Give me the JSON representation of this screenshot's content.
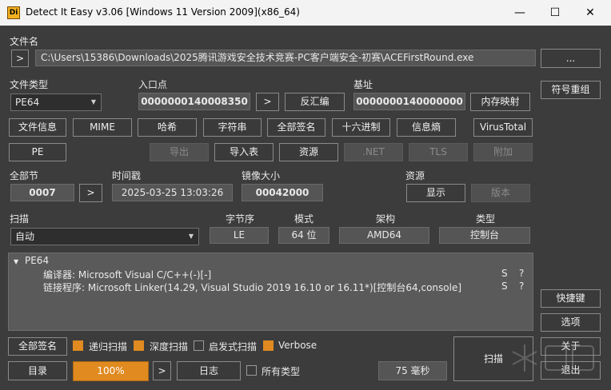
{
  "window": {
    "title": "Detect It Easy v3.06 [Windows 11 Version 2009](x86_64)",
    "icon_text": "Di",
    "minimize": "—",
    "maximize": "☐",
    "close": "✕"
  },
  "file": {
    "label": "文件名",
    "prev_btn": ">",
    "path": "C:\\Users\\15386\\Downloads\\2025腾讯游戏安全技术竞赛-PC客户端安全-初赛\\ACEFirstRound.exe",
    "browse": "..."
  },
  "filetype": {
    "label": "文件类型",
    "value": "PE64"
  },
  "entry": {
    "label": "入口点",
    "value": "0000000140008350",
    "go": ">",
    "disasm": "反汇编"
  },
  "base": {
    "label": "基址",
    "value": "0000000140000000",
    "memmap": "内存映射"
  },
  "right": {
    "sym": "符号重组",
    "shortcut": "快捷键",
    "options": "选项",
    "about": "关于",
    "exit": "退出"
  },
  "toolbar1": [
    "文件信息",
    "MIME",
    "哈希",
    "字符串",
    "全部签名",
    "十六进制",
    "信息熵",
    "VirusTotal"
  ],
  "toolbar2": {
    "pe": "PE",
    "export": "导出",
    "import": "导入表",
    "resource": "资源",
    "net": ".NET",
    "tls": "TLS",
    "overlay": "附加"
  },
  "sections": {
    "label": "全部节",
    "value": "0007",
    "go": ">"
  },
  "timestamp": {
    "label": "时间戳",
    "value": "2025-03-25 13:03:26"
  },
  "imagesize": {
    "label": "镜像大小",
    "value": "00042000"
  },
  "resources": {
    "label": "资源",
    "show": "显示",
    "version": "版本"
  },
  "scan": {
    "label": "扫描",
    "mode": "自动",
    "byteorder_label": "字节序",
    "byteorder": "LE",
    "mode_label": "模式",
    "mode_value": "64 位",
    "arch_label": "架构",
    "arch": "AMD64",
    "type_label": "类型",
    "type": "控制台"
  },
  "results": {
    "root": "PE64",
    "items": [
      {
        "text": "编译器: Microsoft Visual C/C++(-)[-]",
        "s": "S",
        "q": "?"
      },
      {
        "text": "链接程序: Microsoft Linker(14.29, Visual Studio 2019 16.10 or 16.11*)[控制台64,console]",
        "s": "S",
        "q": "?"
      }
    ]
  },
  "bottom": {
    "allsig": "全部签名",
    "recursive": "递归扫描",
    "deep": "深度扫描",
    "heuristic": "启发式扫描",
    "verbose": "Verbose",
    "dir": "目录",
    "progress": "100%",
    "go": ">",
    "log": "日志",
    "alltypes": "所有类型",
    "time": "75 毫秒",
    "scan_btn": "扫描"
  },
  "colors": {
    "accent": "#e08a20",
    "bg": "#3c3c3c"
  }
}
